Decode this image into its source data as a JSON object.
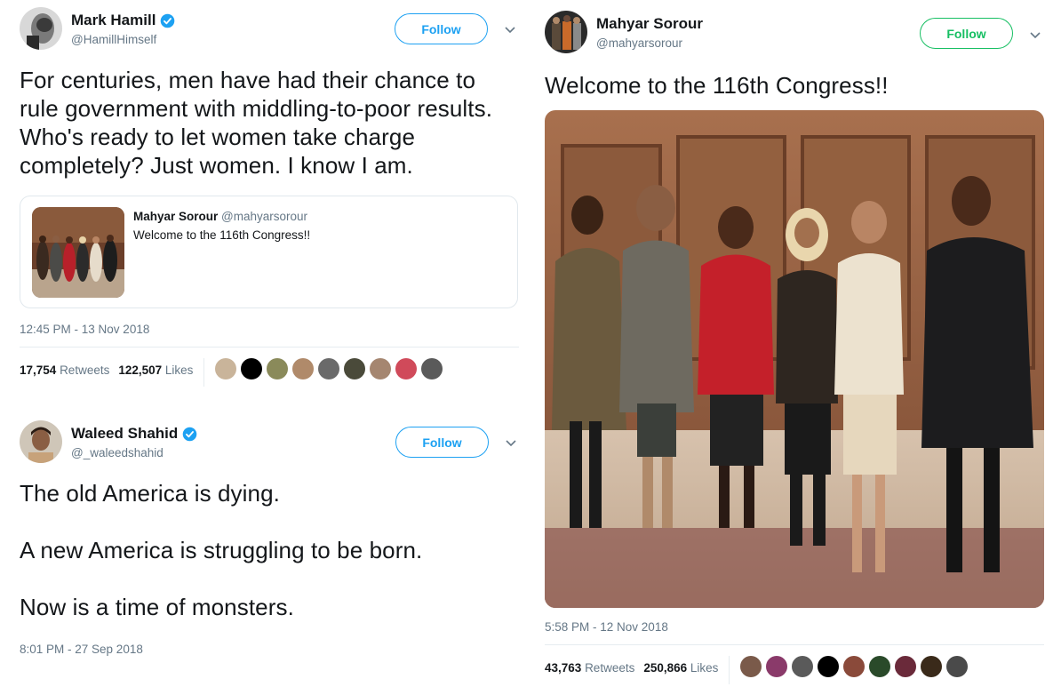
{
  "tweets": [
    {
      "author": {
        "name": "Mark Hamill",
        "handle": "@HamillHimself",
        "verified": true
      },
      "follow_label": "Follow",
      "text": "For centuries, men have had their chance to rule government with middling-to-poor results. Who's ready to let women take charge completely? Just women. I know I am.",
      "quoted": {
        "name": "Mahyar Sorour",
        "handle": "@mahyarsorour",
        "text": "Welcome to the 116th Congress!!"
      },
      "timestamp": "12:45 PM - 13 Nov 2018",
      "retweets_count": "17,754",
      "retweets_label": "Retweets",
      "likes_count": "122,507",
      "likes_label": "Likes"
    },
    {
      "author": {
        "name": "Waleed Shahid",
        "handle": "@_waleedshahid",
        "verified": true
      },
      "follow_label": "Follow",
      "lines": [
        "The old America is dying.",
        "A new America is struggling to be born.",
        "Now is a time of monsters."
      ],
      "timestamp": "8:01 PM - 27 Sep 2018"
    },
    {
      "author": {
        "name": "Mahyar Sorour",
        "handle": "@mahyarsorour",
        "verified": false
      },
      "follow_label": "Follow",
      "text": "Welcome to the 116th Congress!!",
      "timestamp": "5:58 PM - 12 Nov 2018",
      "retweets_count": "43,763",
      "retweets_label": "Retweets",
      "likes_count": "250,866",
      "likes_label": "Likes"
    }
  ],
  "colors": {
    "twitter_blue": "#1da1f2",
    "follow_green": "#17bf63",
    "verified": "#1da1f2",
    "muted": "#657786"
  }
}
